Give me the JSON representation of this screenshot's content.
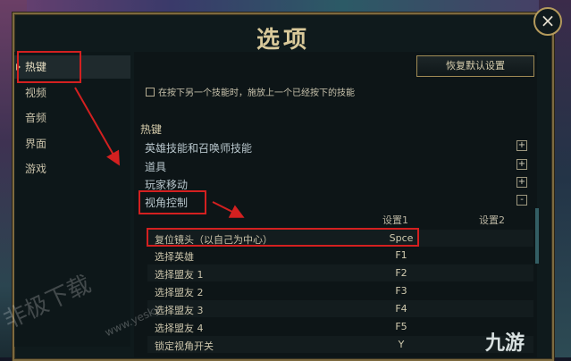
{
  "window": {
    "title": "选项",
    "close_label": "×"
  },
  "sidebar": {
    "items": [
      {
        "label": "热键",
        "active": true
      },
      {
        "label": "视频"
      },
      {
        "label": "音频"
      },
      {
        "label": "界面"
      },
      {
        "label": "游戏"
      }
    ]
  },
  "reset_button": {
    "label": "恢复默认设置"
  },
  "option": {
    "label": "在按下另一个技能时，施放上一个已经按下的技能",
    "checked": false
  },
  "hotkeys": {
    "section_title": "热键",
    "categories": [
      {
        "label": "英雄技能和召唤师技能",
        "toggle": "+"
      },
      {
        "label": "道具",
        "toggle": "+"
      },
      {
        "label": "玩家移动",
        "toggle": "+"
      },
      {
        "label": "视角控制",
        "toggle": "-"
      }
    ],
    "table": {
      "headers": [
        "设置1",
        "设置2"
      ],
      "rows": [
        {
          "label": "复位镜头（以自己为中心）",
          "key1": "Spce",
          "key2": ""
        },
        {
          "label": "选择英雄",
          "key1": "F1",
          "key2": ""
        },
        {
          "label": "选择盟友 1",
          "key1": "F2",
          "key2": ""
        },
        {
          "label": "选择盟友 2",
          "key1": "F3",
          "key2": ""
        },
        {
          "label": "选择盟友 3",
          "key1": "F4",
          "key2": ""
        },
        {
          "label": "选择盟友 4",
          "key1": "F5",
          "key2": ""
        },
        {
          "label": "锁定视角开关",
          "key1": "Y",
          "key2": ""
        }
      ]
    }
  },
  "watermark": {
    "text": "非极下载",
    "url": "www.yesky"
  },
  "brand": {
    "text": "九游"
  },
  "colors": {
    "gold": "#7d6a3f",
    "highlight_red": "#d32020",
    "panel": "#0f1a1c"
  }
}
